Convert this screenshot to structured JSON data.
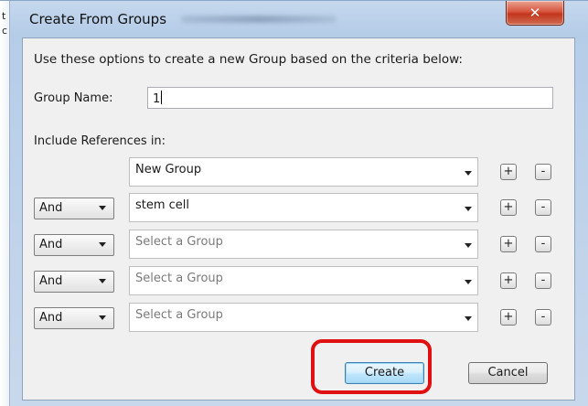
{
  "window": {
    "title": "Create From Groups",
    "close_glyph": "✕",
    "left_strip_chars": [
      "t",
      "c"
    ],
    "colors": {
      "close_button": "#c3351c",
      "highlight": "#e01010"
    }
  },
  "dialog": {
    "description": "Use these options to create a new Group based on the criteria below:",
    "group_name_label": "Group Name:",
    "group_name_value": "1",
    "include_label": "Include References in:",
    "rows": [
      {
        "operator": null,
        "group": "New Group",
        "placeholder": false
      },
      {
        "operator": "And",
        "group": "stem cell",
        "placeholder": false
      },
      {
        "operator": "And",
        "group": "Select a Group",
        "placeholder": true
      },
      {
        "operator": "And",
        "group": "Select a Group",
        "placeholder": true
      },
      {
        "operator": "And",
        "group": "Select a Group",
        "placeholder": true
      }
    ],
    "plus_label": "+",
    "minus_label": "-",
    "create_label": "Create",
    "cancel_label": "Cancel"
  },
  "icons": [
    "close-icon",
    "chevron-down-icon",
    "plus-icon",
    "minus-icon"
  ]
}
